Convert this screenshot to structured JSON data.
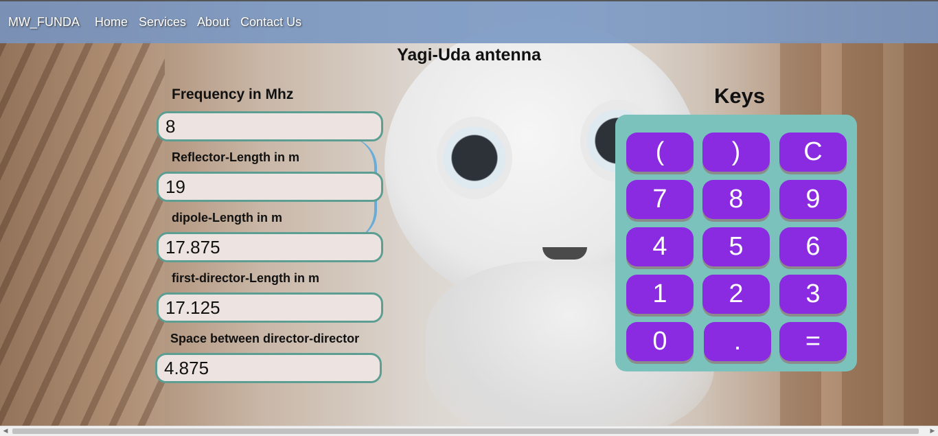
{
  "navbar": {
    "brand": "MW_FUNDA",
    "links": [
      "Home",
      "Services",
      "About",
      "Contact Us"
    ]
  },
  "page": {
    "title": "Yagi-Uda antenna"
  },
  "form": {
    "fields": [
      {
        "label": "Frequency in Mhz",
        "value": "8"
      },
      {
        "label": "Reflector-Length in m",
        "value": "19"
      },
      {
        "label": "dipole-Length in m",
        "value": "17.875"
      },
      {
        "label": "first-director-Length in m",
        "value": "17.125"
      },
      {
        "label": "Space between director-director",
        "value": "4.875"
      }
    ]
  },
  "keypad": {
    "title": "Keys",
    "keys": [
      "(",
      ")",
      "C",
      "7",
      "8",
      "9",
      "4",
      "5",
      "6",
      "1",
      "2",
      "3",
      "0",
      ".",
      "="
    ],
    "colors": {
      "panel": "#7bc2bd",
      "key": "#8a2be2"
    }
  },
  "scrollbar": {
    "left_arrow": "◀",
    "right_arrow": "▶"
  }
}
